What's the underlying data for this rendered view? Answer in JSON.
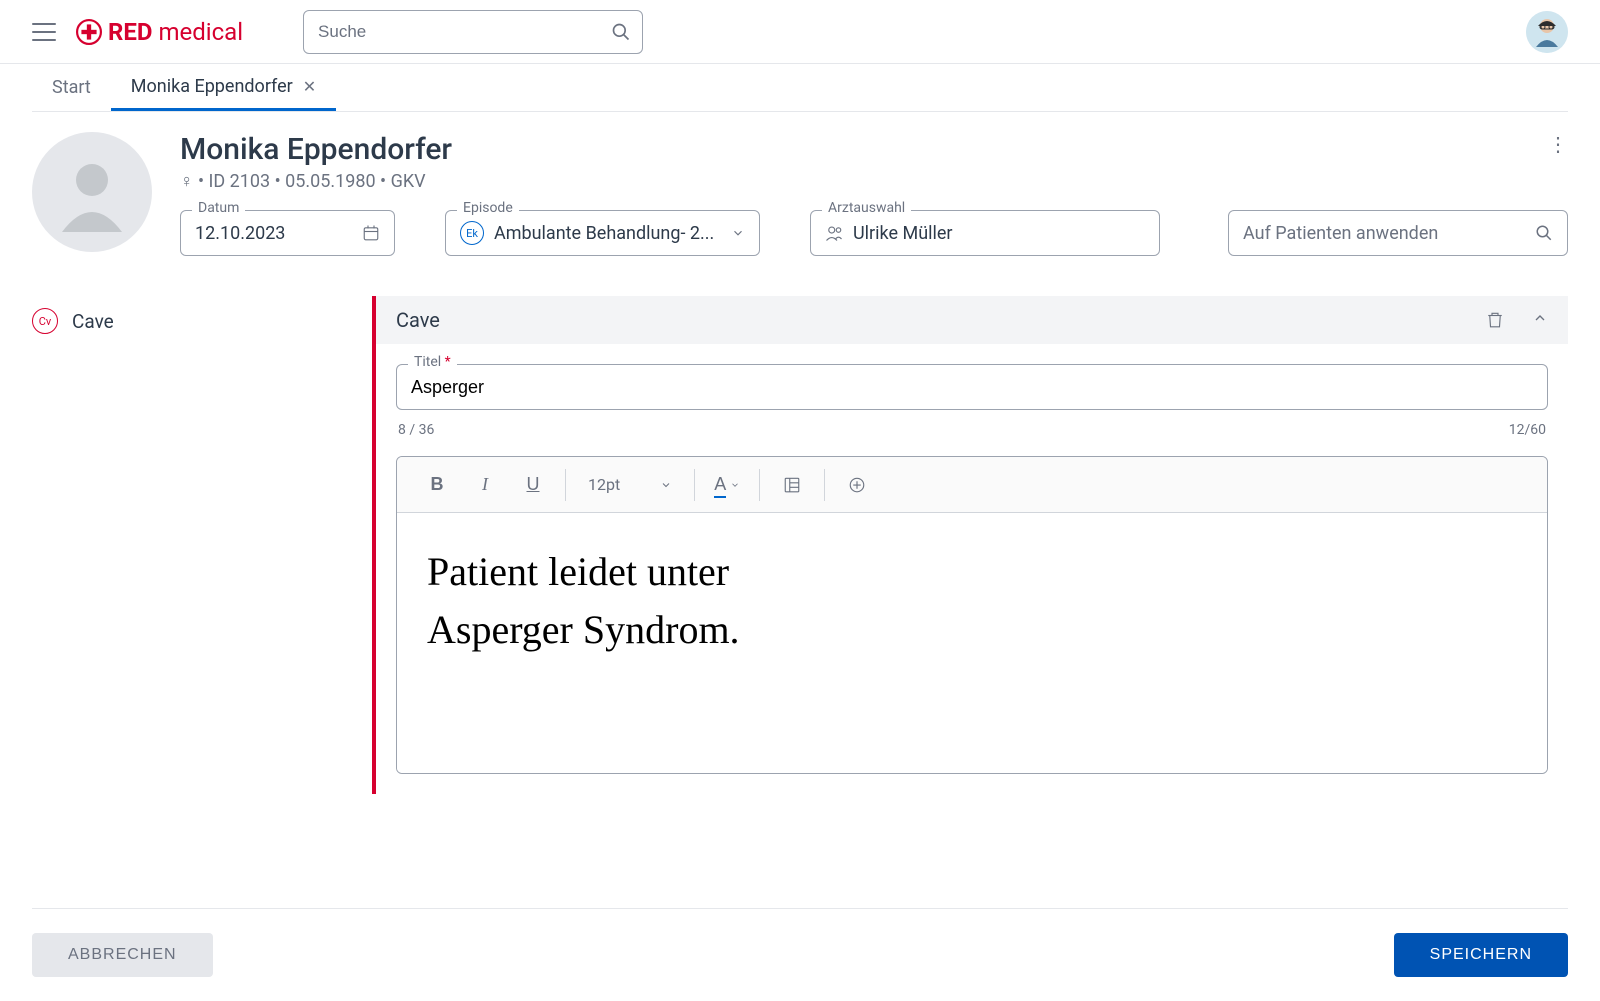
{
  "header": {
    "logo_red": "RED",
    "logo_medical": " medical",
    "search_placeholder": "Suche"
  },
  "tabs": {
    "start": "Start",
    "patient": "Monika Eppendorfer"
  },
  "patient": {
    "name": "Monika Eppendorfer",
    "meta": "♀  •  ID 2103  •  05.05.1980  •  GKV"
  },
  "fields": {
    "datum_label": "Datum",
    "datum_value": "12.10.2023",
    "episode_label": "Episode",
    "episode_badge": "Ek",
    "episode_value": "Ambulante Behandlung- 2...",
    "arzt_label": "Arztauswahl",
    "arzt_value": "Ulrike Müller",
    "apply_placeholder": "Auf Patienten anwenden"
  },
  "sidebar": {
    "cave_badge": "Cv",
    "cave_label": "Cave"
  },
  "panel": {
    "title": "Cave",
    "titel_label": "Titel",
    "titel_value": "Asperger",
    "count_left": "8 / 36",
    "count_right": "12/60",
    "fontsize": "12pt",
    "handwriting_line1": "Patient leidet unter",
    "handwriting_line2": "Asperger Syndrom."
  },
  "footer": {
    "cancel": "ABBRECHEN",
    "save": "SPEICHERN"
  }
}
